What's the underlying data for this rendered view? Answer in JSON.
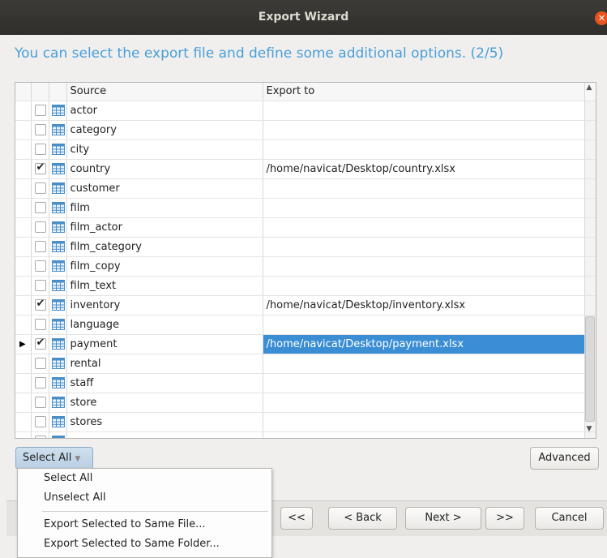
{
  "window": {
    "title": "Export Wizard",
    "close_icon": "close-icon"
  },
  "subtitle": "You can select the export file and define some additional options. (2/5)",
  "grid": {
    "headers": {
      "source": "Source",
      "export_to": "Export to"
    },
    "rows": [
      {
        "name": "actor",
        "checked": false,
        "export_to": ""
      },
      {
        "name": "category",
        "checked": false,
        "export_to": ""
      },
      {
        "name": "city",
        "checked": false,
        "export_to": ""
      },
      {
        "name": "country",
        "checked": true,
        "export_to": "/home/navicat/Desktop/country.xlsx"
      },
      {
        "name": "customer",
        "checked": false,
        "export_to": ""
      },
      {
        "name": "film",
        "checked": false,
        "export_to": ""
      },
      {
        "name": "film_actor",
        "checked": false,
        "export_to": ""
      },
      {
        "name": "film_category",
        "checked": false,
        "export_to": ""
      },
      {
        "name": "film_copy",
        "checked": false,
        "export_to": ""
      },
      {
        "name": "film_text",
        "checked": false,
        "export_to": ""
      },
      {
        "name": "inventory",
        "checked": true,
        "export_to": "/home/navicat/Desktop/inventory.xlsx"
      },
      {
        "name": "language",
        "checked": false,
        "export_to": ""
      },
      {
        "name": "payment",
        "checked": true,
        "export_to": "/home/navicat/Desktop/payment.xlsx",
        "current": true,
        "selected": true
      },
      {
        "name": "rental",
        "checked": false,
        "export_to": ""
      },
      {
        "name": "staff",
        "checked": false,
        "export_to": ""
      },
      {
        "name": "store",
        "checked": false,
        "export_to": ""
      },
      {
        "name": "stores",
        "checked": false,
        "export_to": ""
      },
      {
        "name": "",
        "checked": false,
        "export_to": ""
      }
    ]
  },
  "buttons": {
    "select_all": "Select All",
    "advanced": "Advanced",
    "first": "<<",
    "back": "< Back",
    "next": "Next >",
    "last": ">>",
    "cancel": "Cancel"
  },
  "menu": {
    "items": [
      "Select All",
      "Unselect All",
      "Export Selected to Same File...",
      "Export Selected to Same Folder..."
    ]
  },
  "colors": {
    "accent": "#4a9fd8",
    "selection": "#3b8ed4",
    "close": "#e95420"
  }
}
